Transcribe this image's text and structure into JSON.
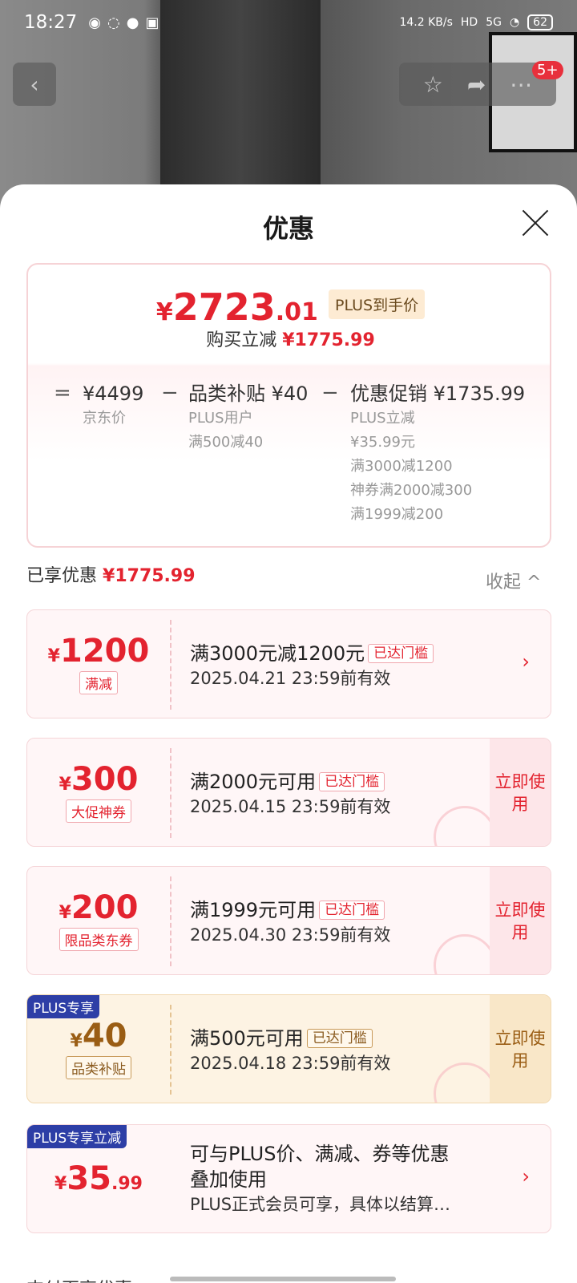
{
  "status": {
    "time": "18:27",
    "net_speed": "14.2 KB/s",
    "network": "5G",
    "battery": "62"
  },
  "header": {
    "cart_badge": "5+"
  },
  "sheet": {
    "title": "优惠",
    "summary": {
      "currency": "¥",
      "price_int": "2723",
      "price_dec": ".01",
      "price_tag": "PLUS到手价",
      "buy_reduce_label": "购买立减",
      "buy_reduce_value": "¥1775.99",
      "eq": "=",
      "minus1": "−",
      "minus2": "−",
      "jd_price": "¥4499",
      "jd_price_label": "京东价",
      "cat_subsidy_label": "品类补贴",
      "cat_subsidy_value": "¥40",
      "cat_subsidy_note1": "PLUS用户",
      "cat_subsidy_note2": "满500减40",
      "promo_label": "优惠促销",
      "promo_value": "¥1735.99",
      "promo_note1": "PLUS立减",
      "promo_note2": "¥35.99元",
      "promo_note3": "满3000减1200",
      "promo_note4": "神券满2000减300",
      "promo_note5": "满1999减200"
    },
    "enjoyed_label": "已享优惠",
    "enjoyed_value": "¥1775.99",
    "collapse_label": "收起 ^",
    "coupons": [
      {
        "amount": "1200",
        "kind": "满减",
        "title": "满3000元减1200元",
        "reach": "已达门槛",
        "valid": "2025.04.21 23:59前有效"
      },
      {
        "amount": "300",
        "kind": "大促神券",
        "title": "满2000元可用",
        "reach": "已达门槛",
        "valid": "2025.04.15 23:59前有效",
        "action": "立即使用"
      },
      {
        "amount": "200",
        "kind": "限品类东券",
        "title": "满1999元可用",
        "reach": "已达门槛",
        "valid": "2025.04.30 23:59前有效",
        "action": "立即使用"
      },
      {
        "plus_label": "PLUS专享",
        "amount": "40",
        "kind": "品类补贴",
        "title": "满500元可用",
        "reach": "已达门槛",
        "valid": "2025.04.18 23:59前有效",
        "action": "立即使用"
      },
      {
        "plus_label": "PLUS专享立减",
        "amount": "35",
        "decimal": ".99",
        "title1": "可与PLUS价、满减、券等优惠",
        "title2": "叠加使用",
        "note": "PLUS正式会员可享，具体以结算…"
      }
    ],
    "footer_peek": "支付页享优惠"
  }
}
